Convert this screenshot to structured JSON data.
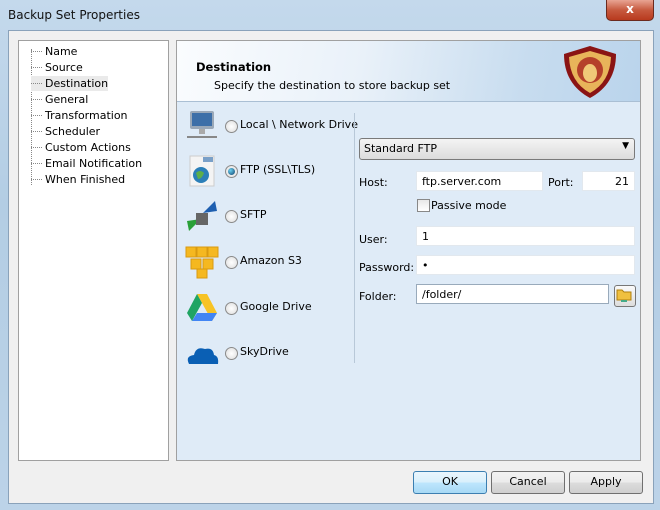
{
  "window": {
    "title": "Backup Set Properties",
    "close": "x"
  },
  "tree": [
    "Name",
    "Source",
    "Destination",
    "General",
    "Transformation",
    "Scheduler",
    "Custom Actions",
    "Email Notification",
    "When Finished"
  ],
  "header": {
    "title": "Destination",
    "subtitle": "Specify the destination to store backup set"
  },
  "options": [
    {
      "label": "Local \\ Network Drive",
      "selected": false,
      "icon": "computer-icon"
    },
    {
      "label": "FTP (SSL\\TLS)",
      "selected": true,
      "icon": "ftp-globe-icon"
    },
    {
      "label": "SFTP",
      "selected": false,
      "icon": "sftp-lock-icon"
    },
    {
      "label": "Amazon S3",
      "selected": false,
      "icon": "amazon-s3-icon"
    },
    {
      "label": "Google Drive",
      "selected": false,
      "icon": "google-drive-icon"
    },
    {
      "label": "SkyDrive",
      "selected": false,
      "icon": "skydrive-cloud-icon"
    }
  ],
  "ftp": {
    "type": "Standard FTP",
    "host_label": "Host:",
    "host": "ftp.server.com",
    "port_label": "Port:",
    "port": "21",
    "passive_label": "Passive mode",
    "passive": false,
    "user_label": "User:",
    "user": "1",
    "password_label": "Password:",
    "password": "•",
    "folder_label": "Folder:",
    "folder": "/folder/"
  },
  "buttons": {
    "ok": "OK",
    "cancel": "Cancel",
    "apply": "Apply"
  }
}
